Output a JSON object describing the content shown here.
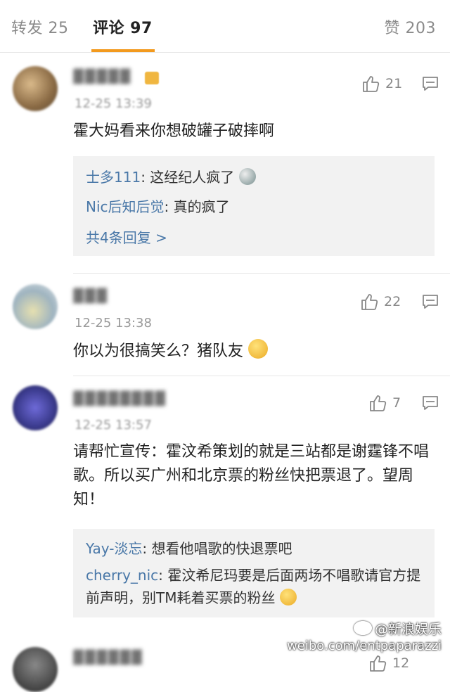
{
  "tabs": {
    "repost": "转发 25",
    "comment": "评论 97",
    "like": "赞 203"
  },
  "comments": [
    {
      "name": "▓▓▓▓▓",
      "time": "12-25 13:39",
      "likes": "21",
      "text": "霍大妈看来你想破罐子破摔啊",
      "replies": [
        {
          "name": "士多111",
          "text": ": 这经纪人疯了"
        },
        {
          "name": "Nic后知后觉",
          "text": ": 真的疯了"
        }
      ],
      "more": "共4条回复 >"
    },
    {
      "name": "▓▓▓",
      "time": "12-25 13:38",
      "likes": "22",
      "text": "你以为很搞笑么？猪队友"
    },
    {
      "name": "▓▓▓▓▓▓▓▓",
      "time": "12-25 13:57",
      "likes": "7",
      "text": "请帮忙宣传：霍汶希策划的就是三站都是谢霆锋不唱歌。所以买广州和北京票的粉丝快把票退了。望周知！",
      "replies": [
        {
          "name": "Yay-淡忘",
          "text": ": 想看他唱歌的快退票吧"
        },
        {
          "name": "cherry_nic",
          "text": ": 霍汶希尼玛要是后面两场不唱歌请官方提前声明，别TM耗着买票的粉丝"
        }
      ]
    }
  ],
  "watermark": {
    "line1": "@新浪娱乐",
    "line2": "weibo.com/entpaparazzi"
  },
  "bottom_likes": "12"
}
